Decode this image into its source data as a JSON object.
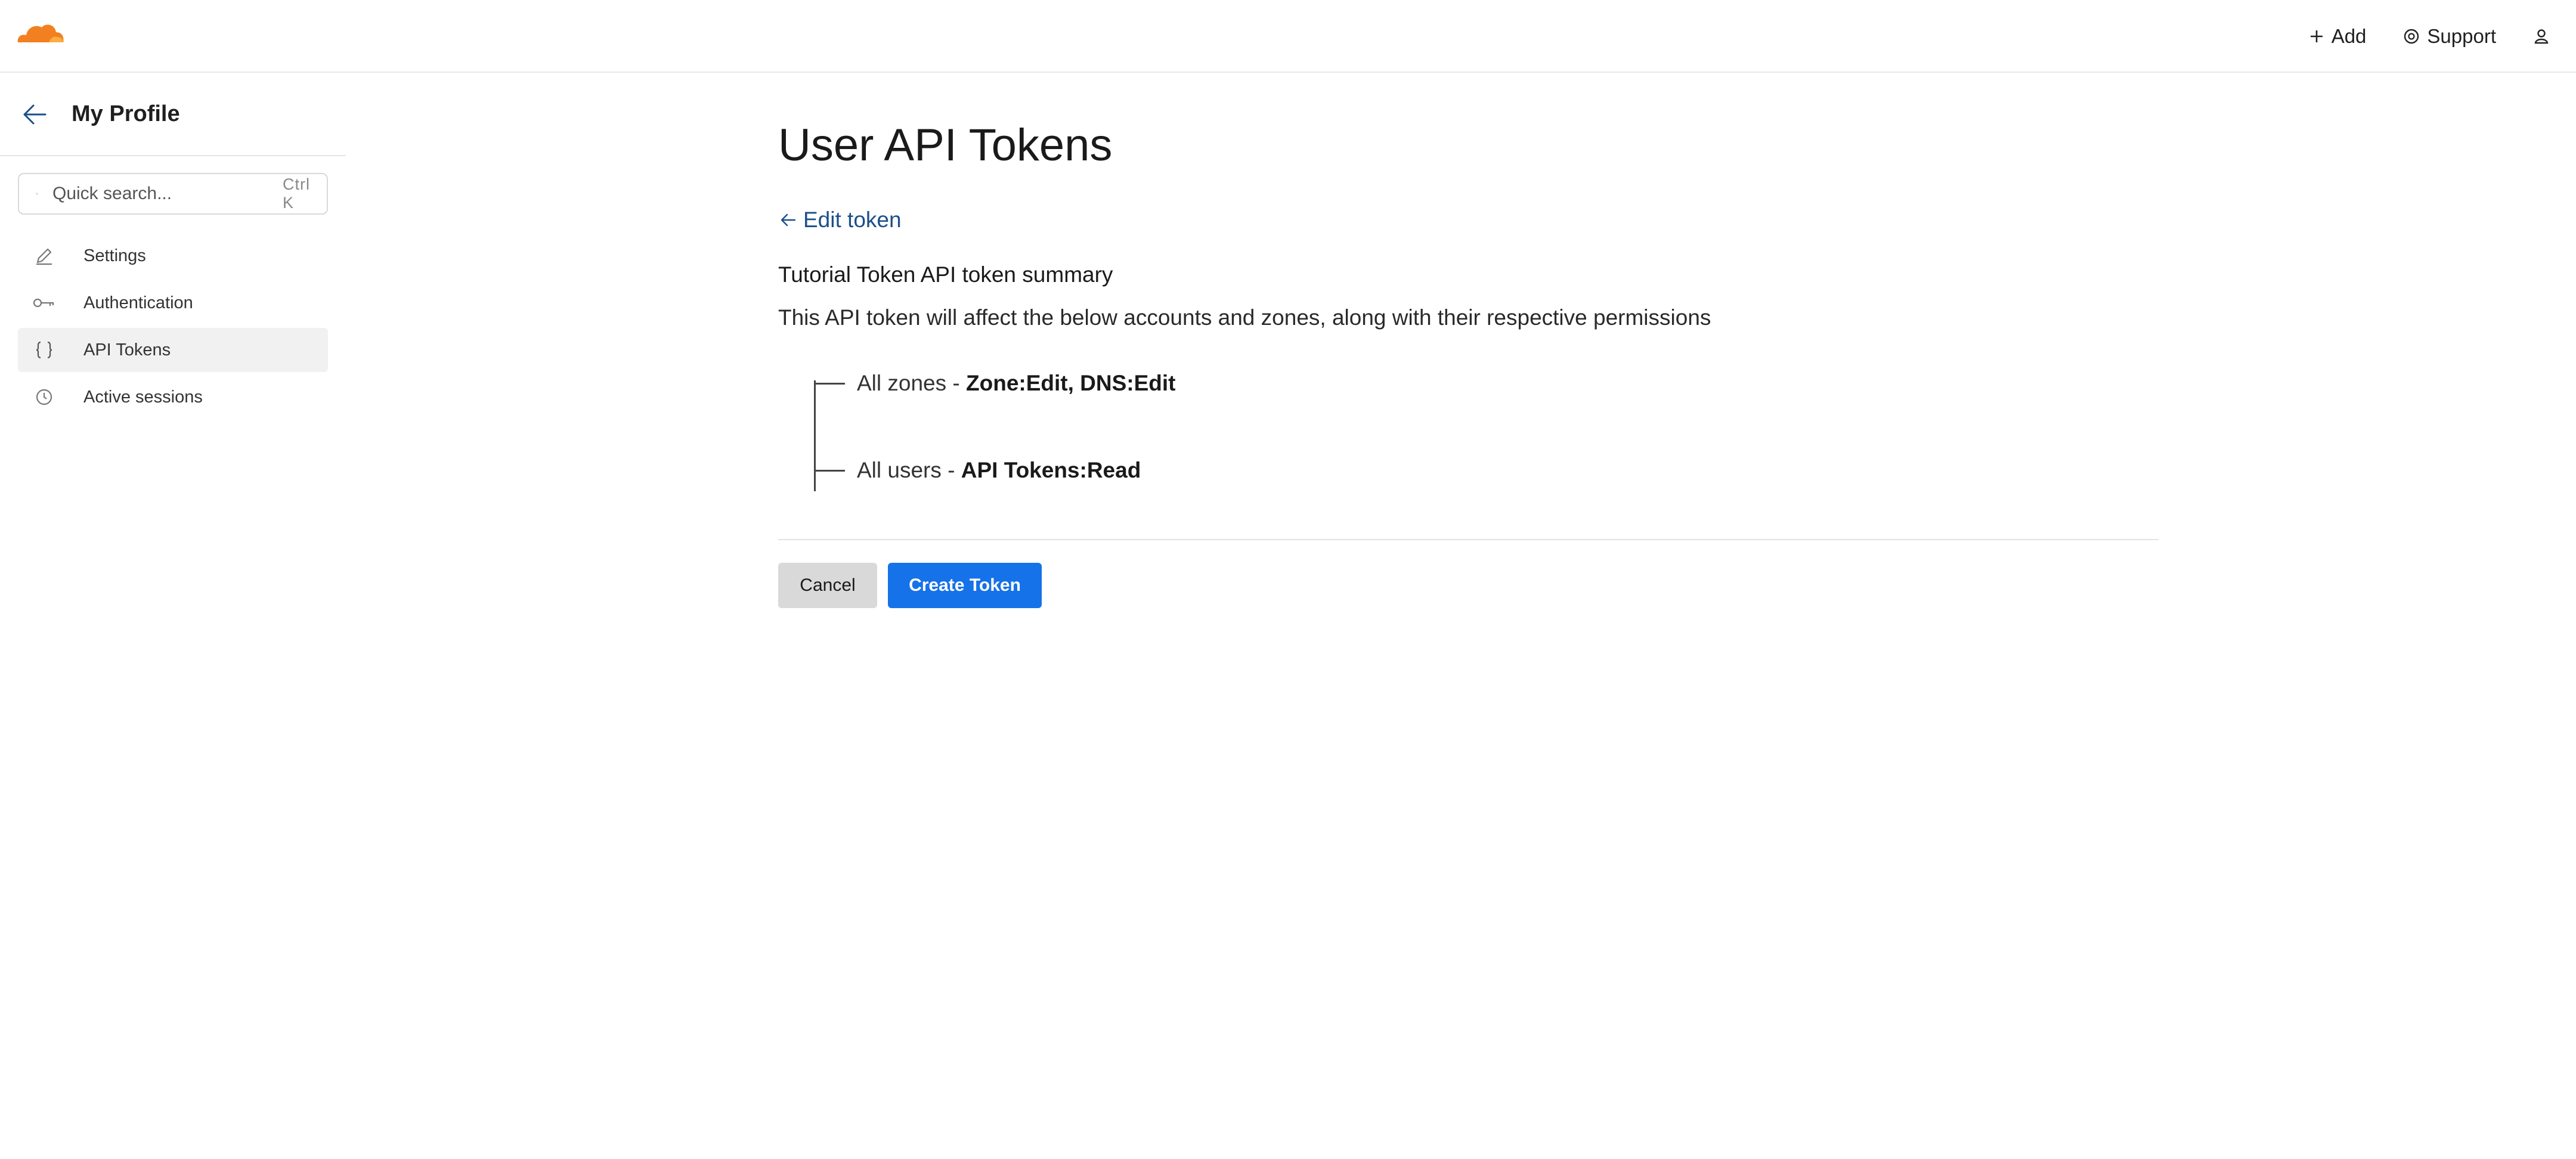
{
  "topbar": {
    "add_label": "Add",
    "support_label": "Support",
    "icons": {
      "logo": "cloudflare-cloud-logo",
      "add": "plus-icon",
      "support": "help-circle-icon",
      "user": "user-icon"
    }
  },
  "sidebar": {
    "title": "My Profile",
    "search": {
      "placeholder": "Quick search...",
      "shortcut": "Ctrl K"
    },
    "items": [
      {
        "label": "Settings",
        "icon": "pencil-icon",
        "active": false
      },
      {
        "label": "Authentication",
        "icon": "key-icon",
        "active": false
      },
      {
        "label": "API Tokens",
        "icon": "braces-icon",
        "active": true
      },
      {
        "label": "Active sessions",
        "icon": "clock-icon",
        "active": false
      }
    ]
  },
  "main": {
    "page_title": "User API Tokens",
    "edit_link": "Edit token",
    "summary_title": "Tutorial Token API token summary",
    "summary_desc": "This API token will affect the below accounts and zones, along with their respective permissions",
    "tree": [
      {
        "scope": "All zones - ",
        "perms": "Zone:Edit, DNS:Edit"
      },
      {
        "scope": "All users - ",
        "perms": "API Tokens:Read"
      }
    ],
    "buttons": {
      "cancel": "Cancel",
      "create": "Create Token"
    }
  },
  "colors": {
    "accent": "#1572e8",
    "link": "#1a4f8a",
    "logo_orange": "#f38020",
    "active_bg": "#f1f1f1"
  }
}
